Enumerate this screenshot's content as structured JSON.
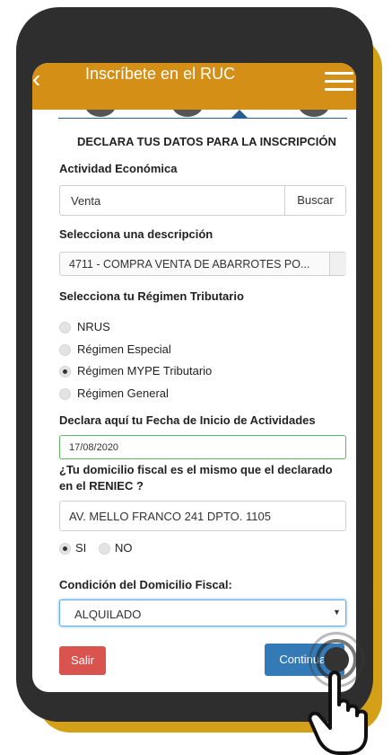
{
  "header": {
    "title": "Inscríbete en el RUC"
  },
  "form": {
    "heading": "DECLARA TUS DATOS PARA LA INSCRIPCIÓN",
    "actividad_label": "Actividad Económica",
    "actividad_value": "Venta",
    "buscar_label": "Buscar",
    "descripcion_label": "Selecciona una descripción",
    "descripcion_value": "4711 - COMPRA VENTA DE ABARROTES PO...",
    "regimen_label": "Selecciona tu Régimen Tributario",
    "regimen_options": [
      "NRUS",
      "Régimen Especial",
      "Régimen MYPE Tributario",
      "Régimen General"
    ],
    "regimen_selected": "Régimen MYPE Tributario",
    "fecha_label": "Declara aquí tu Fecha de Inicio de Actividades",
    "fecha_value": "17/08/2020",
    "domicilio_question_line1": "¿Tu domicilio fiscal es el mismo que el declarado",
    "domicilio_question_line2": "en el RENIEC ?",
    "domicilio_value": "AV. MELLO FRANCO 241 DPTO. 1105",
    "si_label": "SI",
    "no_label": "NO",
    "si_no_selected": "SI",
    "condicion_label": "Condición del Domicilio Fiscal:",
    "condicion_value": "ALQUILADO"
  },
  "buttons": {
    "salir": "Salir",
    "continuar": "Continuar"
  },
  "colors": {
    "appbar": "#d48f17",
    "frame_accent": "#d4a017",
    "primary": "#337ab7",
    "danger": "#d9534f",
    "active_border": "#5cb85c"
  }
}
